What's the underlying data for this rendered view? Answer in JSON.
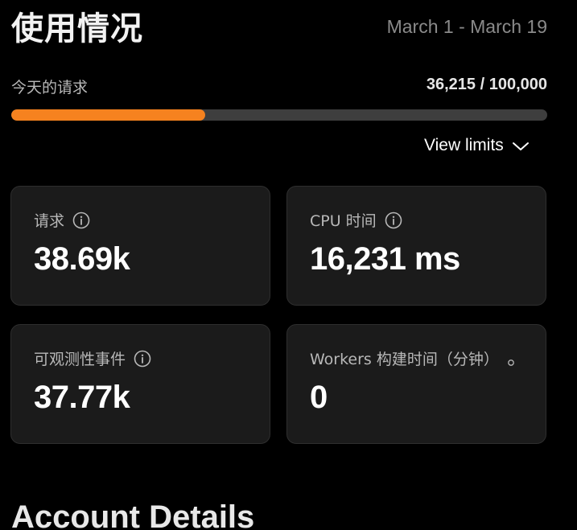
{
  "header": {
    "title": "使用情况",
    "date_range": "March 1 - March 19"
  },
  "usage": {
    "label": "今天的请求",
    "count_text": "36,215 / 100,000",
    "progress_fraction": 0.36215,
    "accent_color": "#f6821f"
  },
  "view_limits": {
    "label": "View limits",
    "icon": "chevron-down-icon"
  },
  "cards": [
    {
      "label": "请求",
      "value": "38.69k",
      "icon": "info-icon"
    },
    {
      "label": "CPU 时间",
      "value": "16,231 ms",
      "icon": "info-icon"
    },
    {
      "label": "可观测性事件",
      "value": "37.77k",
      "icon": "info-icon"
    },
    {
      "label": "Workers 构建时间（分钟）",
      "value": "0",
      "icon": "dot-icon"
    }
  ],
  "account_section": {
    "title": "Account Details"
  }
}
